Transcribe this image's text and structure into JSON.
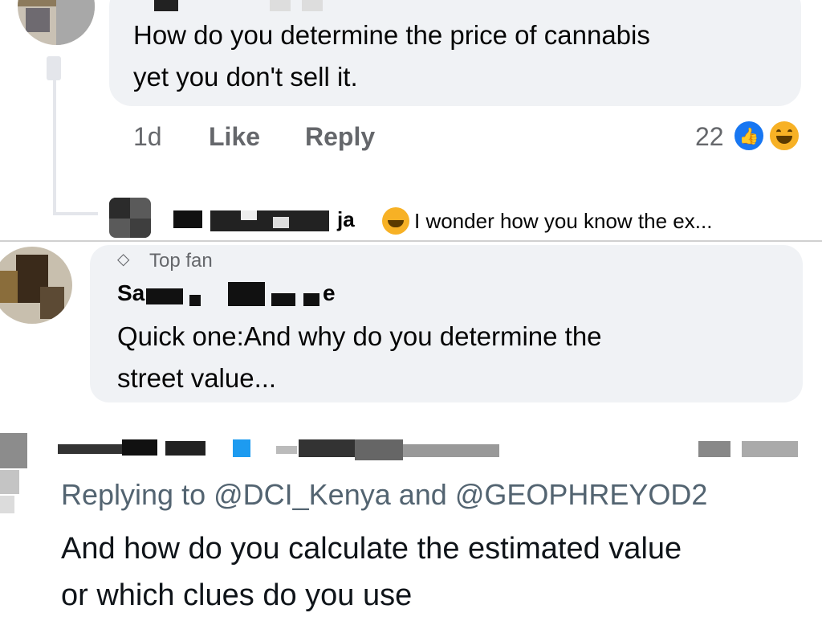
{
  "comment1": {
    "text_line1": "How do you determine the price of cannabis",
    "text_line2": "yet you don't sell it.",
    "time": "1d",
    "like_label": "Like",
    "reply_label": "Reply",
    "reaction_count": "22",
    "reactions": [
      "like-icon",
      "haha-icon"
    ]
  },
  "reply_preview": {
    "name_suffix": "ja",
    "text": "I wonder how you know the ex..."
  },
  "comment2": {
    "badge": "Top fan",
    "name_prefix": "Sa",
    "name_suffix": "e",
    "text_line1": "Quick one:And why do you determine the",
    "text_line2": "street value..."
  },
  "tweet": {
    "replying_to": "Replying to @DCI_Kenya and @GEOPHREYOD2",
    "text_line1": "And how do you calculate the estimated value",
    "text_line2": "or which clues do you use"
  },
  "colors": {
    "bubble": "#f0f2f5",
    "meta": "#65676b",
    "like_blue": "#1877f2",
    "haha_yellow": "#f7b125",
    "twitter_blue": "#1d9bf0",
    "twitter_gray": "#536471"
  }
}
